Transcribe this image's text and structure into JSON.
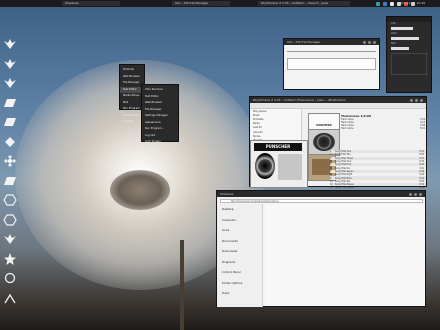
{
  "topbar": {
    "tasks": [
      "Shadows",
      "Xsh - Xfe File Manager",
      "Rhythmbox 2.3.25 - Untitled ... Search - Jussi",
      "2011-11-25 10:49"
    ],
    "tray_colors": [
      "#2ca6a4",
      "#3b7fd0",
      "#e6e6e6",
      "#d8d8d8",
      "#e84a3a",
      "#c9c9c9"
    ]
  },
  "dock": {
    "icons": [
      "wing-icon",
      "wing-icon",
      "wing-icon",
      "parallelogram-icon",
      "parallelogram-icon",
      "diamond-icon",
      "flower-icon",
      "parallelogram-icon",
      "hexagon-icon",
      "hexagon-icon",
      "wing-icon",
      "star-icon",
      "circle-icon",
      "power-icon"
    ]
  },
  "sys_panel": {
    "labels": [
      "CPU",
      "RAM",
      "NET"
    ]
  },
  "terminal": {
    "title": "Xsh - Xfe File Manager"
  },
  "context_menu": {
    "items": [
      "Terminal",
      "Web Browser",
      "File Manager",
      "Text Editor",
      "Media Player",
      "Mail",
      "Run Program",
      "Preferences",
      "Log Out"
    ]
  },
  "submenu": {
    "items": [
      "Xfce Terminal",
      "Text Editor",
      "Web Browser",
      "File Manager",
      "Settings Manager",
      "Appearance",
      "Run Program...",
      "Log Out",
      "Lock Screen",
      "Screenshot",
      "About Xfce",
      "Help"
    ]
  },
  "rhythmbox": {
    "title": "Rhythmbox 2.3.25 - Untitled (Thelonious - Jussi ...  Rhythmbox",
    "library": [
      "Play Queue",
      "Music",
      "Podcasts",
      "Radio",
      "Last.fm",
      "Libre.fm",
      "Stores",
      "Playlists",
      "My Top Rated",
      "Recently Added",
      "Recently Played"
    ],
    "now_playing": "Thelonious 1/4/20",
    "album_top": "PUNCHERS",
    "side_tracks": [
      "Track name",
      "Track name",
      "Track name",
      "Track name"
    ],
    "side_durations": [
      "3:34",
      "4:12",
      "2:58",
      "5:01"
    ],
    "tracks": [
      [
        "1",
        "Song Title One",
        "3:12"
      ],
      [
        "2",
        "Song Title Two",
        "4:05"
      ],
      [
        "3",
        "Song Title Three",
        "2:47"
      ],
      [
        "4",
        "Song Title Four",
        "3:33"
      ],
      [
        "5",
        "Song Title Five",
        "4:20"
      ],
      [
        "6",
        "Song Title Six",
        "3:01"
      ],
      [
        "7",
        "Song Title Seven",
        "2:59"
      ],
      [
        "8",
        "Song Title Eight",
        "3:44"
      ],
      [
        "9",
        "Song Title Nine",
        "4:10"
      ],
      [
        "10",
        "Song Title Ten",
        "3:25"
      ],
      [
        "11",
        "Song Title Eleven",
        "2:52"
      ],
      [
        "12",
        "Song Title Twelve",
        "3:38"
      ]
    ],
    "right_list": [
      [
        "1",
        "Artist Track 01"
      ],
      [
        "2",
        "Artist Track 02"
      ],
      [
        "3",
        "Artist Track 03"
      ],
      [
        "4",
        "Artist Track 04"
      ],
      [
        "5",
        "Artist Track 05"
      ],
      [
        "6",
        "Artist Track 06"
      ],
      [
        "7",
        "Artist Track 07"
      ],
      [
        "8",
        "Artist Track 08"
      ],
      [
        "9",
        "Artist Track 09"
      ],
      [
        "10",
        "Artist Track 10"
      ],
      [
        "11",
        "Artist Track 11"
      ],
      [
        "12",
        "Artist Track 12"
      ],
      [
        "13",
        "Artist Track 13"
      ],
      [
        "14",
        "Artist Track 14"
      ],
      [
        "15",
        "Artist Track 15"
      ],
      [
        "16",
        "Artist Track 16"
      ],
      [
        "17",
        "Artist Track 17"
      ],
      [
        "18",
        "Artist Track 18"
      ],
      [
        "19",
        "Artist Track 19"
      ],
      [
        "20",
        "Artist Track 20"
      ]
    ]
  },
  "file_manager": {
    "title": "Shadows",
    "path": "file:///home/user/.local/share/applications",
    "sidebar": [
      "Desktop",
      "Computer",
      "Links",
      "Documents",
      "Downloads",
      "Programs",
      "Control Panel",
      "Folder Options",
      "Trash"
    ]
  }
}
